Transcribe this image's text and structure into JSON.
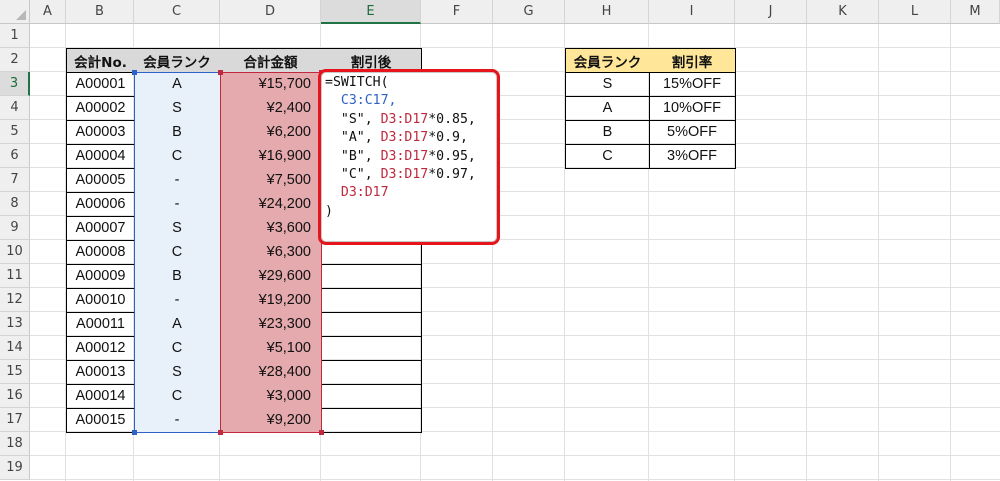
{
  "columns": [
    "A",
    "B",
    "C",
    "D",
    "E",
    "F",
    "G",
    "H",
    "I",
    "J",
    "K",
    "L",
    "M"
  ],
  "rows": [
    "1",
    "2",
    "3",
    "4",
    "5",
    "6",
    "7",
    "8",
    "9",
    "10",
    "11",
    "12",
    "13",
    "14",
    "15",
    "16",
    "17",
    "18",
    "19"
  ],
  "active_column": "E",
  "active_row": "3",
  "main_table": {
    "headers": [
      "会計No.",
      "会員ランク",
      "合計金額",
      "割引後"
    ],
    "records": [
      [
        "A00001",
        "A",
        "¥15,700"
      ],
      [
        "A00002",
        "S",
        "¥2,400"
      ],
      [
        "A00003",
        "B",
        "¥6,200"
      ],
      [
        "A00004",
        "C",
        "¥16,900"
      ],
      [
        "A00005",
        "-",
        "¥7,500"
      ],
      [
        "A00006",
        "-",
        "¥24,200"
      ],
      [
        "A00007",
        "S",
        "¥3,600"
      ],
      [
        "A00008",
        "C",
        "¥6,300"
      ],
      [
        "A00009",
        "B",
        "¥29,600"
      ],
      [
        "A00010",
        "-",
        "¥19,200"
      ],
      [
        "A00011",
        "A",
        "¥23,300"
      ],
      [
        "A00012",
        "C",
        "¥5,100"
      ],
      [
        "A00013",
        "S",
        "¥28,400"
      ],
      [
        "A00014",
        "C",
        "¥3,000"
      ],
      [
        "A00015",
        "-",
        "¥9,200"
      ]
    ]
  },
  "rate_table": {
    "headers": [
      "会員ランク",
      "割引率"
    ],
    "records": [
      [
        "S",
        "15%OFF"
      ],
      [
        "A",
        "10%OFF"
      ],
      [
        "B",
        "5%OFF"
      ],
      [
        "C",
        "3%OFF"
      ]
    ]
  },
  "formula": {
    "line1": "=SWITCH(",
    "line2_ref": "C3:C17",
    "line2_tail": ",",
    "cases": [
      {
        "key": "\"S\", ",
        "ref": "D3:D17",
        "mult": "*0.85,"
      },
      {
        "key": "\"A\", ",
        "ref": "D3:D17",
        "mult": "*0.9,"
      },
      {
        "key": "\"B\", ",
        "ref": "D3:D17",
        "mult": "*0.95,"
      },
      {
        "key": "\"C\", ",
        "ref": "D3:D17",
        "mult": "*0.97,"
      }
    ],
    "default_ref": "D3:D17",
    "close": ")"
  },
  "colors": {
    "ref_blue": "#2f62c8",
    "ref_red": "#c0293d",
    "callout_border": "#e6141b",
    "header_yellow": "#ffe699",
    "header_gray": "#d9d9d9",
    "blue_fill": "#e8f0fa",
    "red_fill": "#e4aaad",
    "select_green": "#217346"
  }
}
